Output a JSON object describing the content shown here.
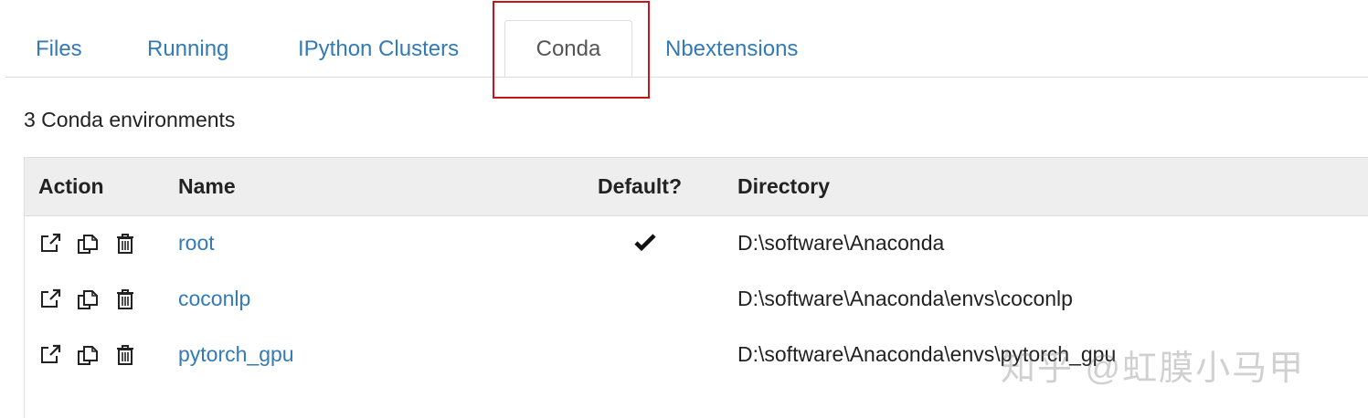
{
  "tabs": [
    {
      "label": "Files",
      "active": false
    },
    {
      "label": "Running",
      "active": false
    },
    {
      "label": "IPython Clusters",
      "active": false
    },
    {
      "label": "Conda",
      "active": true
    },
    {
      "label": "Nbextensions",
      "active": false
    }
  ],
  "env_count_text": "3 Conda environments",
  "table": {
    "headers": {
      "action": "Action",
      "name": "Name",
      "default": "Default?",
      "directory": "Directory"
    },
    "rows": [
      {
        "name": "root",
        "default": true,
        "directory": "D:\\software\\Anaconda"
      },
      {
        "name": "coconlp",
        "default": false,
        "directory": "D:\\software\\Anaconda\\envs\\coconlp"
      },
      {
        "name": "pytorch_gpu",
        "default": false,
        "directory": "D:\\software\\Anaconda\\envs\\pytorch_gpu"
      }
    ],
    "action_icons": [
      "export-icon",
      "clone-icon",
      "trash-icon"
    ]
  },
  "watermark": "知乎 @虹膜小马甲",
  "colors": {
    "link": "#337ab7",
    "header_bg": "#eeeeee",
    "highlight_box": "#c4161c"
  }
}
